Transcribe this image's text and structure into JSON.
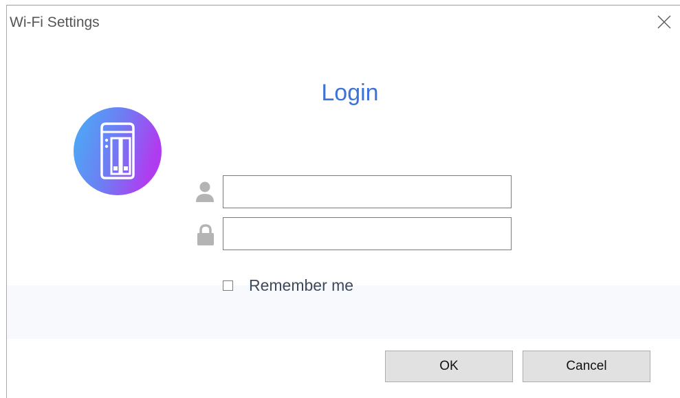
{
  "window": {
    "title": "Wi-Fi Settings",
    "close_icon": "close-icon"
  },
  "login": {
    "heading": "Login",
    "app_logo_icon": "nas-device-icon",
    "username": {
      "icon": "user-icon",
      "value": "",
      "placeholder": ""
    },
    "password": {
      "icon": "lock-icon",
      "value": "",
      "placeholder": ""
    },
    "remember_me": {
      "label": "Remember me",
      "checked": false
    }
  },
  "buttons": {
    "ok_label": "OK",
    "cancel_label": "Cancel"
  },
  "colors": {
    "heading": "#3b73d8",
    "logo_gradient_start": "#4aa8f5",
    "logo_gradient_end": "#a541f0",
    "button_bg": "#e1e1e1",
    "footer_band": "#f7f9fc"
  }
}
